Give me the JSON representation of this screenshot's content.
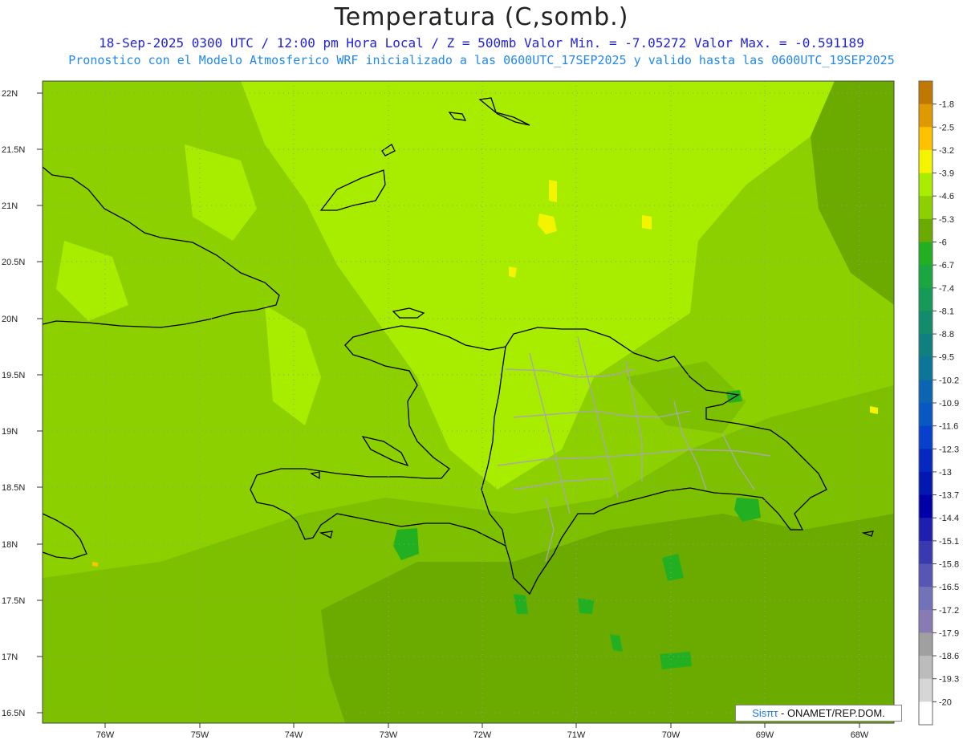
{
  "header": {
    "title": "Temperatura (C,somb.)",
    "subtitle1": "18-Sep-2025 0300 UTC / 12:00 pm Hora Local / Z = 500mb Valor Min. = -7.05272  Valor Max. = -0.591189",
    "subtitle2": "Pronostico con el Modelo Atmosferico WRF inicializado a las 0600UTC_17SEP2025 y valido hasta las  0600UTC_19SEP2025"
  },
  "map": {
    "lat_labels": [
      "22N",
      "21.5N",
      "21N",
      "20.5N",
      "20N",
      "19.5N",
      "19N",
      "18.5N",
      "18N",
      "17.5N",
      "17N",
      "16.5N"
    ],
    "lon_labels": [
      "76W",
      "75W",
      "74W",
      "73W",
      "72W",
      "71W",
      "70W",
      "69W",
      "68W"
    ],
    "colors": {
      "base": "#8cd000",
      "light": "#a8ec00",
      "medium": "#7cc000",
      "dark": "#6bab00",
      "green": "#22b022",
      "yellow": "#f4f400",
      "coast": "#000000",
      "provinces": "#a8a8a8",
      "grid": "#999999"
    }
  },
  "colorbar": {
    "labels": [
      "-1.8",
      "-2.5",
      "-3.2",
      "-3.9",
      "-4.6",
      "-5.3",
      "-6",
      "-6.7",
      "-7.4",
      "-8.1",
      "-8.8",
      "-9.5",
      "-10.2",
      "-10.9",
      "-11.6",
      "-12.3",
      "-13",
      "-13.7",
      "-14.4",
      "-15.1",
      "-15.8",
      "-16.5",
      "-17.2",
      "-17.9",
      "-18.6",
      "-19.3",
      "-20"
    ],
    "colors": [
      "#c07800",
      "#e09a00",
      "#ffc200",
      "#f4f400",
      "#a8ec00",
      "#8cd000",
      "#6bab00",
      "#22b022",
      "#1aa640",
      "#169a58",
      "#128c6c",
      "#0e8080",
      "#0c7698",
      "#0a66b0",
      "#0858c4",
      "#0640cc",
      "#0428c0",
      "#0218b0",
      "#0000a8",
      "#1e1eb0",
      "#3a3ab0",
      "#5656b4",
      "#7272b8",
      "#8a7ab4",
      "#a0a0a0",
      "#bcbcbc",
      "#d6d6d6",
      "#ffffff"
    ]
  },
  "credit": {
    "brand": "Sisπτ",
    "org": "- ONAMET/REP.DOM."
  }
}
